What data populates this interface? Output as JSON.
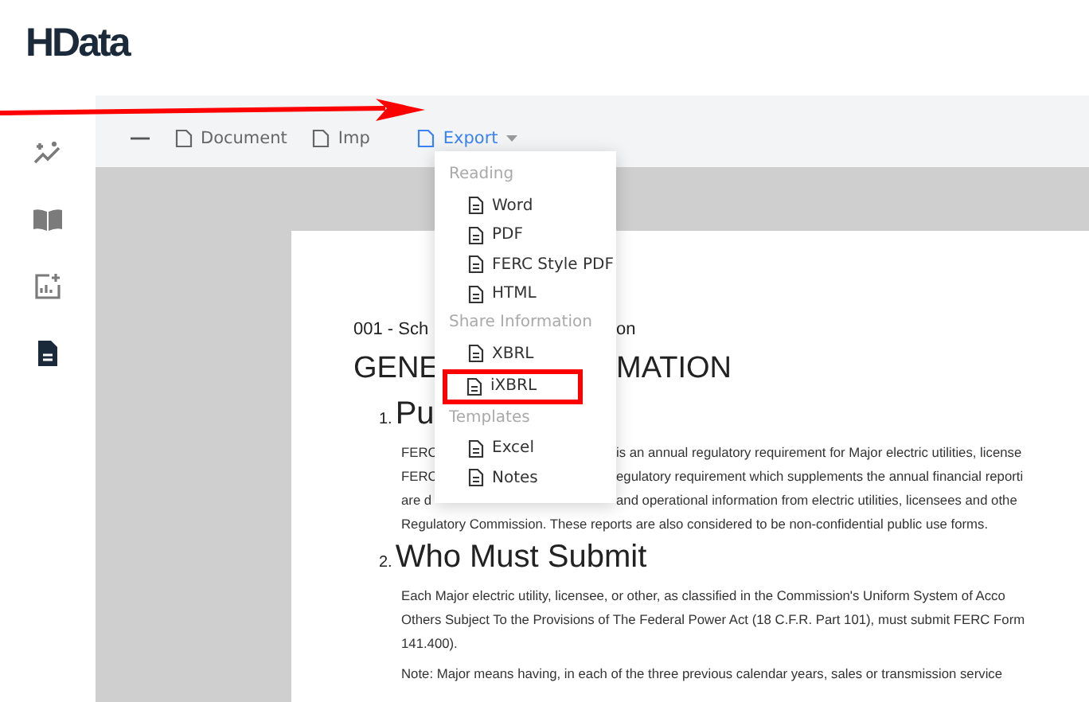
{
  "logo": "HData",
  "sidebar": {
    "items": [
      {
        "selected": false
      },
      {
        "selected": false
      },
      {
        "selected": false
      },
      {
        "selected": true
      }
    ]
  },
  "toolbar": {
    "items": [
      {
        "label": "Document",
        "selected": false,
        "dropdown": false
      },
      {
        "label": "Imp",
        "selected": false,
        "dropdown": false
      },
      {
        "label": "Export",
        "selected": true,
        "dropdown": true
      }
    ]
  },
  "document": {
    "lines": [
      {
        "kind": "subtitle",
        "left": "001 - Sch",
        "right": "on"
      },
      {
        "kind": "title",
        "left": "GENE",
        "right": "MATION"
      },
      {
        "kind": "heading",
        "number": "1.",
        "left": "Pu"
      },
      {
        "kind": "para",
        "left": "FERC",
        "right": "is an annual regulatory requirement for Major electric utilities, license"
      },
      {
        "kind": "para",
        "left": "FERC",
        "right": "egulatory requirement which supplements the annual financial reporti"
      },
      {
        "kind": "para",
        "left": "are d",
        "right": "and operational information from electric utilities, licensees and othe"
      },
      {
        "kind": "para",
        "left": "Regulatory Commission. These reports are also considered to be non-confidential public use forms."
      },
      {
        "kind": "heading",
        "number": "2.",
        "left": "Who Must Submit"
      },
      {
        "kind": "para",
        "left": "Each Major electric utility, licensee, or other, as classified in the Commission's Uniform System of Acco"
      },
      {
        "kind": "para",
        "left": "Others Subject To the Provisions of The Federal Power Act (18 C.F.R. Part 101), must submit FERC Form"
      },
      {
        "kind": "para",
        "left": "141.400)."
      },
      {
        "kind": "note",
        "left": "Note: Major means having, in each of the three previous calendar years, sales or transmission service"
      }
    ]
  },
  "export_menu": {
    "groups": [
      {
        "title": "Reading",
        "items": [
          {
            "label": "Word",
            "highlighted": false
          },
          {
            "label": "PDF",
            "highlighted": false
          },
          {
            "label": "FERC Style PDF",
            "highlighted": false
          },
          {
            "label": "HTML",
            "highlighted": false
          }
        ]
      },
      {
        "title": "Share Information",
        "items": [
          {
            "label": "XBRL",
            "highlighted": false
          },
          {
            "label": "iXBRL",
            "highlighted": true
          }
        ]
      },
      {
        "title": "Templates",
        "items": [
          {
            "label": "Excel",
            "highlighted": false
          },
          {
            "label": "Notes",
            "highlighted": false
          }
        ]
      }
    ]
  }
}
